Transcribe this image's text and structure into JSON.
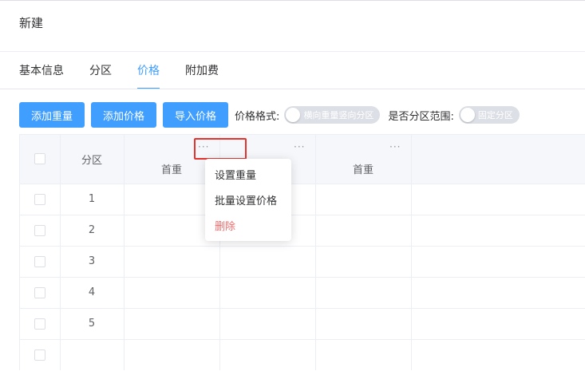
{
  "page": {
    "title": "新建"
  },
  "tabs": [
    {
      "label": "基本信息",
      "active": false
    },
    {
      "label": "分区",
      "active": false
    },
    {
      "label": "价格",
      "active": true
    },
    {
      "label": "附加费",
      "active": false
    }
  ],
  "toolbar": {
    "add_weight_label": "添加重量",
    "add_price_label": "添加价格",
    "import_price_label": "导入价格",
    "price_format_label": "价格格式:",
    "price_format_switch_text": "横向重量竖向分区",
    "zone_range_label": "是否分区范围:",
    "zone_range_switch_text": "固定分区"
  },
  "table": {
    "zone_header": "分区",
    "price_headers": [
      "首重",
      "",
      "首重"
    ],
    "more_icon_text": "···",
    "rows": [
      "1",
      "2",
      "3",
      "4",
      "5",
      ""
    ]
  },
  "dropdown": {
    "items": [
      {
        "label": "设置重量",
        "danger": false
      },
      {
        "label": "批量设置价格",
        "danger": false
      },
      {
        "label": "删除",
        "danger": true
      }
    ]
  },
  "colors": {
    "primary": "#409eff",
    "danger": "#f56c6c",
    "highlight": "#e5322d"
  }
}
